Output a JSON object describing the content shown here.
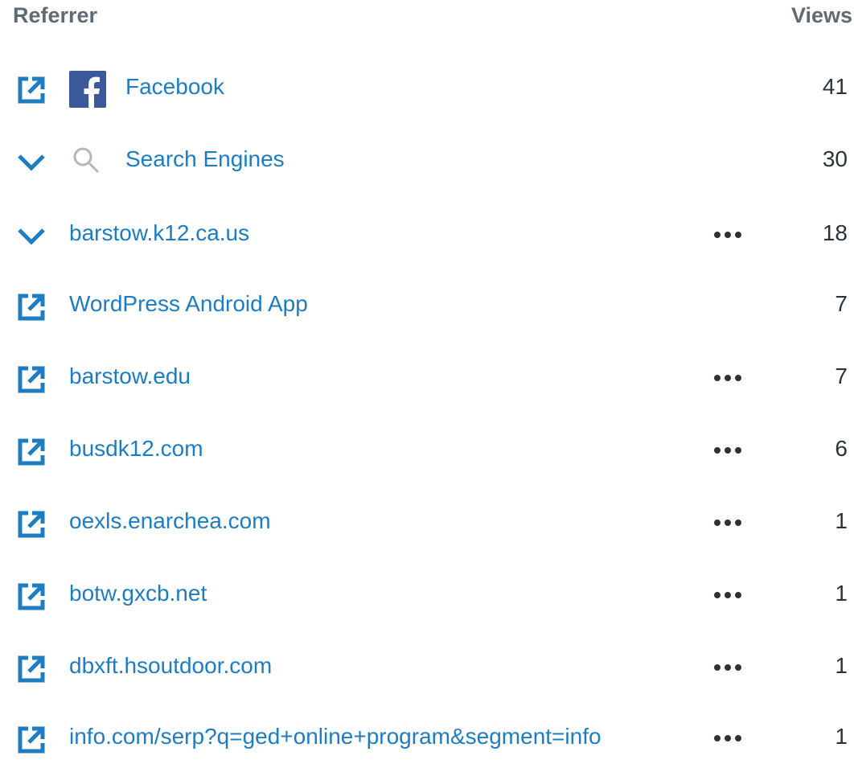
{
  "header": {
    "referrer_label": "Referrer",
    "views_label": "Views"
  },
  "colors": {
    "link": "#1e7cc1",
    "header": "#5f6b73",
    "count": "#2c3338",
    "facebook": "#3b5998"
  },
  "rows": [
    {
      "label": "Facebook",
      "views": "41",
      "lead_icon": "external-link-icon",
      "site_icon": "facebook-icon",
      "has_more": false
    },
    {
      "label": "Search Engines",
      "views": "30",
      "lead_icon": "chevron-down-icon",
      "site_icon": "search-icon",
      "has_more": false
    },
    {
      "label": "barstow.k12.ca.us",
      "views": "18",
      "lead_icon": "chevron-down-icon",
      "has_more": true
    },
    {
      "label": "WordPress Android App",
      "views": "7",
      "lead_icon": "external-link-icon",
      "has_more": false
    },
    {
      "label": "barstow.edu",
      "views": "7",
      "lead_icon": "external-link-icon",
      "has_more": true
    },
    {
      "label": "busdk12.com",
      "views": "6",
      "lead_icon": "external-link-icon",
      "has_more": true
    },
    {
      "label": "oexls.enarchea.com",
      "views": "1",
      "lead_icon": "external-link-icon",
      "has_more": true
    },
    {
      "label": "botw.gxcb.net",
      "views": "1",
      "lead_icon": "external-link-icon",
      "has_more": true
    },
    {
      "label": "dbxft.hsoutdoor.com",
      "views": "1",
      "lead_icon": "external-link-icon",
      "has_more": true
    },
    {
      "label": "info.com/serp?q=ged+online+program&segment=info",
      "views": "1",
      "lead_icon": "external-link-icon",
      "has_more": true
    }
  ]
}
